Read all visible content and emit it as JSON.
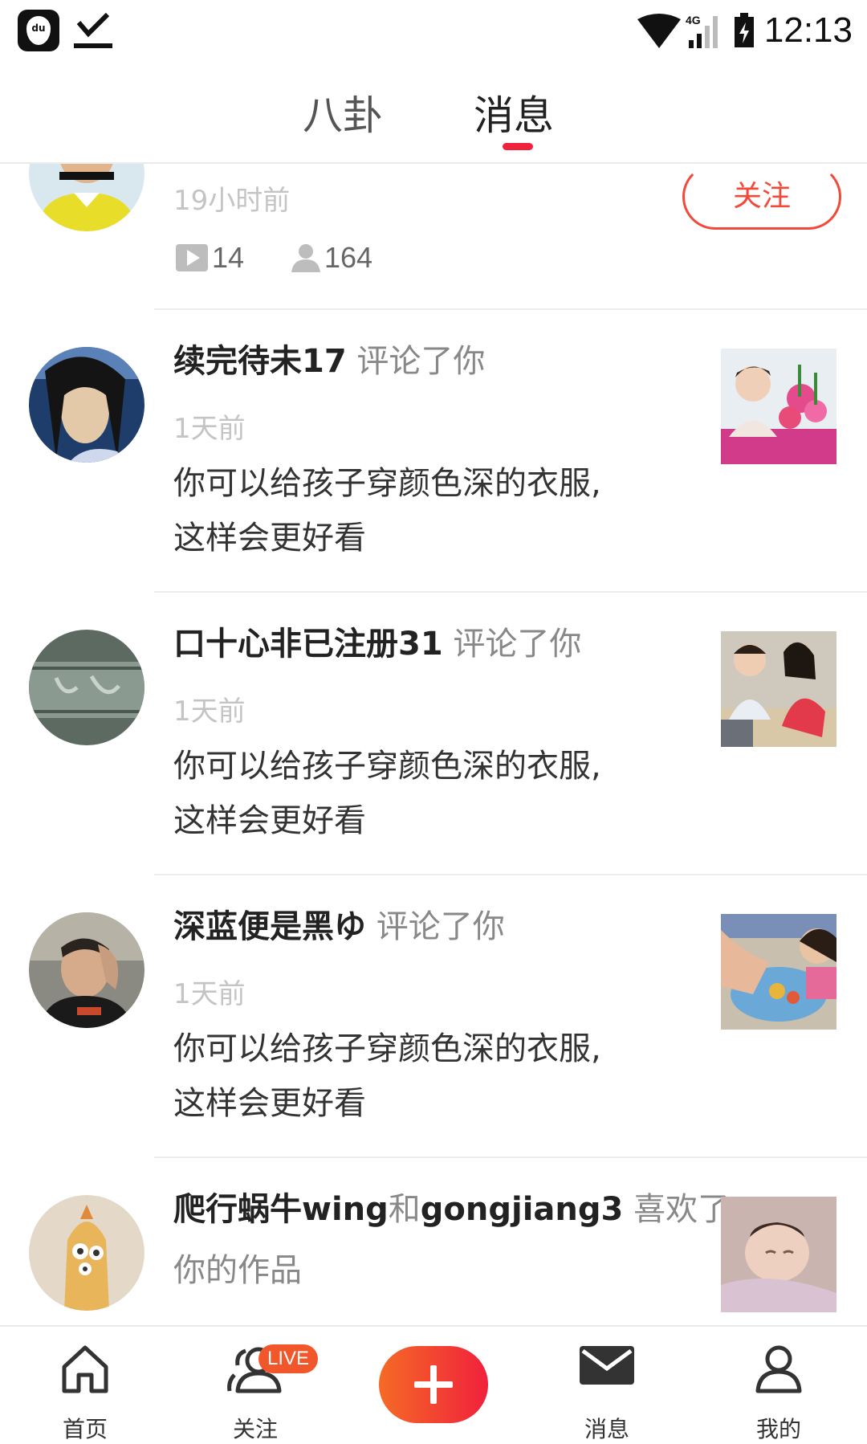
{
  "status_bar": {
    "app_icon_text": "du",
    "network": "4G",
    "time": "12:13"
  },
  "tabs": {
    "gossip": "八卦",
    "messages": "消息",
    "active": "messages",
    "accent_color": "#f0213c"
  },
  "partial_item": {
    "time": "19小时前",
    "follow_label": "关注",
    "videos_count": "14",
    "followers_count": "164"
  },
  "messages": [
    {
      "name": "续完待未17",
      "action": "评论了你",
      "time": "1天前",
      "comment_line1": "你可以给孩子穿颜色深的衣服,",
      "comment_line2": "这样会更好看"
    },
    {
      "name": "口十心非已注册31",
      "action": "评论了你",
      "time": "1天前",
      "comment_line1": "你可以给孩子穿颜色深的衣服,",
      "comment_line2": "这样会更好看"
    },
    {
      "name": "深蓝便是黑ゆ",
      "action": "评论了你",
      "time": "1天前",
      "comment_line1": "你可以给孩子穿颜色深的衣服,",
      "comment_line2": "这样会更好看"
    },
    {
      "name_part1": "爬行蜗牛wing",
      "connector": "和",
      "name_part2": "gongjiang3",
      "action_line1": "喜欢了",
      "action_line2": "你的作品"
    }
  ],
  "bottom_nav": {
    "home": "首页",
    "follow": "关注",
    "live_badge": "LIVE",
    "messages": "消息",
    "me": "我的"
  }
}
